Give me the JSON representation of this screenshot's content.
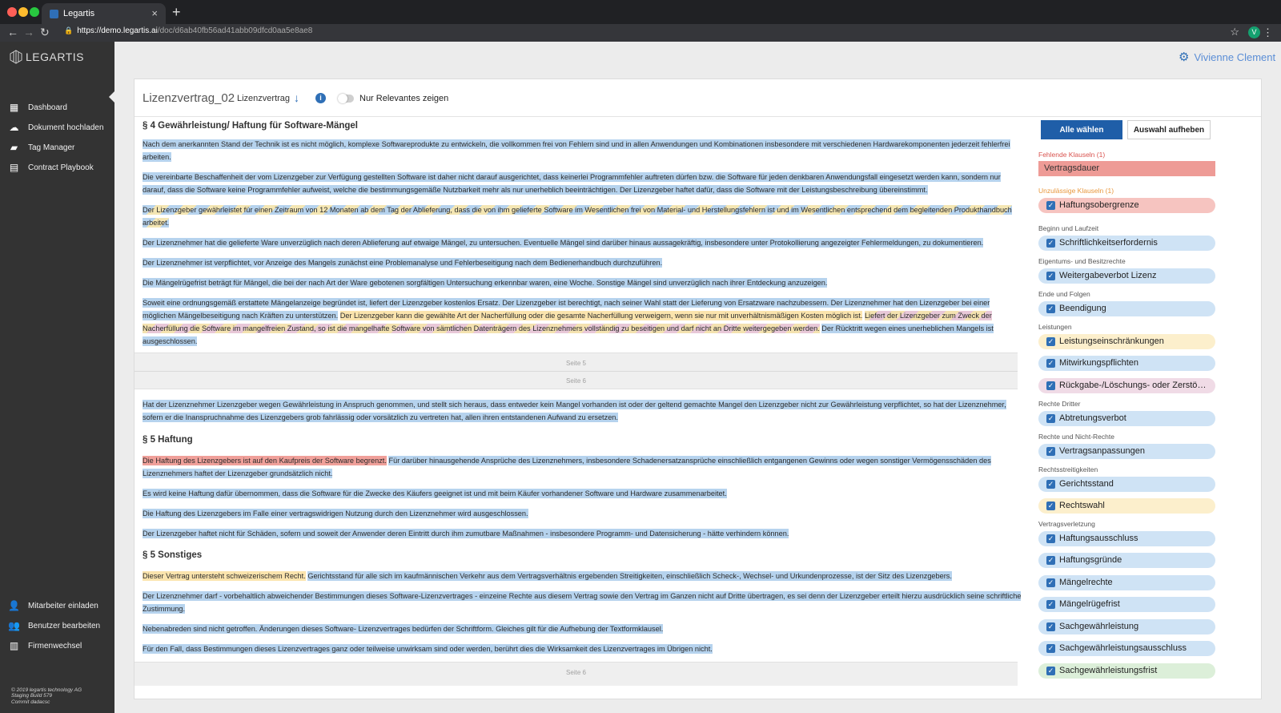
{
  "browser": {
    "tab_title": "Legartis",
    "tab_close": "×",
    "new_tab": "+",
    "url_host": "https://demo.legartis.ai",
    "url_path": "/doc/d6ab40fb56ad41abb09dfcd0aa5e8ae8",
    "profile_initial": "V"
  },
  "sidebar": {
    "logo": "LEGARTIS",
    "items": [
      {
        "label": "Dashboard",
        "icon": "dashboard-icon"
      },
      {
        "label": "Dokument hochladen",
        "icon": "cloud-upload-icon"
      },
      {
        "label": "Tag Manager",
        "icon": "tag-icon"
      },
      {
        "label": "Contract Playbook",
        "icon": "playbook-icon"
      }
    ],
    "bottom_items": [
      {
        "label": "Mitarbeiter einladen",
        "icon": "user-add-icon"
      },
      {
        "label": "Benutzer bearbeiten",
        "icon": "users-icon"
      },
      {
        "label": "Firmenwechsel",
        "icon": "building-icon"
      }
    ],
    "footer": [
      "© 2019 legartis technology AG",
      "Staging Build 579",
      "Commit dadacsc"
    ]
  },
  "user": {
    "name": "Vivienne Clement"
  },
  "doc": {
    "title": "Lizenzvertrag_02",
    "type": "Lizenzvertrag",
    "toggle_label": "Nur Relevantes zeigen",
    "page_labels": [
      "Seite 5",
      "Seite 6",
      "Seite 6"
    ],
    "sections": {
      "s4": "§ 4 Gewährleistung/ Haftung für Software-Mängel",
      "s5": "§ 5 Haftung",
      "s6": "§ 5 Sonstiges"
    },
    "p1": "Nach dem anerkannten Stand der Technik ist es nicht möglich, komplexe Softwareprodukte zu entwickeln, die vollkommen frei von Fehlern sind und in allen Anwendungen und Kombinationen insbesondere mit verschiedenen Hardwarekomponenten jederzeit fehlerfrei arbeiten.",
    "p2": "Die vereinbarte Beschaffenheit der vom Lizenzgeber zur Verfügung gestellten Software ist daher nicht darauf ausgerichtet, dass keinerlei Programmfehler auftreten dürfen bzw. die Software für jeden denkbaren Anwendungsfall eingesetzt werden kann, sondern nur darauf, dass die Software keine Programmfehler aufweist, welche die bestimmungsgemäße Nutzbarkeit mehr als nur unerheblich beeinträchtigen. Der Lizenzgeber haftet dafür, dass die Software mit der Leistungsbeschreibung übereinstimmt.",
    "p3": "Der Lizenzgeber gewährleistet für einen Zeitraum von 12 Monaten ab dem Tag der Ablieferung, dass die von ihm gelieferte Software im Wesentlichen frei von Material- und Herstellungsfehlern ist und im Wesentlichen entsprechend dem begleitenden Produkthandbuch arbeitet.",
    "p4": "Der Lizenznehmer hat die gelieferte Ware unverzüglich nach deren Ablieferung auf etwaige Mängel, zu untersuchen. Eventuelle Mängel sind darüber hinaus aussagekräftig, insbesondere unter Protokollierung angezeigter Fehlermeldungen, zu dokumentieren.",
    "p5": "Der Lizenznehmer ist verpflichtet, vor Anzeige des Mangels zunächst eine Problemanalyse und Fehlerbeseitigung nach dem Bedienerhandbuch durchzuführen.",
    "p6": "Die Mängelrügefrist beträgt für Mängel, die bei der nach Art der Ware gebotenen sorgfältigen Untersuchung erkennbar waren, eine Woche. Sonstige Mängel sind unverzüglich nach ihrer Entdeckung anzuzeigen.",
    "p7a": "Soweit eine ordnungsgemäß erstattete Mängelanzeige begründet ist, liefert der Lizenzgeber kostenlos Ersatz. Der Lizenzgeber ist berechtigt, nach seiner Wahl statt der Lieferung von Ersatzware nachzubessern. Der Lizenznehmer hat den Lizenzgeber bei einer möglichen Mängelbeseitigung nach Kräften zu unterstützen.",
    "p7b": "Der Lizenzgeber kann die gewählte Art der Nacherfüllung oder die gesamte Nacherfüllung verweigern, wenn sie nur mit unverhältnismäßigen Kosten möglich ist.",
    "p7c": "Liefert der Lizenzgeber zum Zweck der Nacherfüllung die Software im mangelfreien Zustand, so ist die mangelhafte Software von sämtlichen Datenträgern des Lizenznehmers vollständig zu beseitigen und darf nicht an Dritte weitergegeben werden.",
    "p7d": "Der Rücktritt wegen eines unerheblichen Mangels ist ausgeschlossen.",
    "p8": "Hat der Lizenznehmer Lizenzgeber wegen Gewährleistung in Anspruch genommen, und stellt sich heraus, dass entweder kein Mangel vorhanden ist oder der geltend gemachte Mangel den Lizenzgeber nicht zur Gewährleistung verpflichtet, so hat der Lizenznehmer, sofern er die Inanspruchnahme des Lizenzgebers grob fahrlässig oder vorsätzlich zu vertreten hat, allen ihren entstandenen Aufwand zu ersetzen.",
    "p9a": "Die Haftung des Lizenzgebers ist auf den Kaufpreis der Software begrenzt.",
    "p9b": "Für darüber hinausgehende Ansprüche des Lizenznehmers, insbesondere Schadenersatzansprüche einschließlich entgangenen Gewinns oder wegen sonstiger Vermögensschäden des Lizenznehmers haftet der Lizenzgeber grundsätzlich nicht.",
    "p10": "Es wird keine Haftung dafür übernommen, dass die Software für die Zwecke des Käufers geeignet ist und mit beim Käufer vorhandener Software und Hardware zusammenarbeitet.",
    "p11": "Die Haftung des Lizenzgebers im Falle einer vertragswidrigen Nutzung durch den Lizenznehmer wird ausgeschlossen.",
    "p12": "Der Lizenzgeber haftet nicht für Schäden, sofern und soweit der Anwender deren Eintritt durch ihm zumutbare Maßnahmen - insbesondere Programm- und Datensicherung - hätte verhindern können.",
    "p13a": "Dieser Vertrag untersteht schweizerischem Recht.",
    "p13b": "Gerichtsstand für alle sich im kaufmännischen Verkehr aus dem Vertragsverhältnis ergebenden Streitigkeiten, einschließlich Scheck-, Wechsel- und Urkundenprozesse, ist der Sitz des Lizenzgebers.",
    "p14": "Der Lizenznehmer darf - vorbehaltlich abweichender Bestimmungen dieses Software-Lizenzvertrages - einzeine Rechte aus diesem Vertrag sowie den Vertrag im Ganzen nicht auf Dritte übertragen, es sei denn der Lizenzgeber erteilt hierzu ausdrücklich seine schriftliche Zustimmung.",
    "p15": "Nebenabreden sind nicht getroffen. Änderungen dieses Software- Lizenzvertrages bedürfen der Schriftform. Gleiches gilt für die Aufhebung der Textformklausel.",
    "p16": "Für den Fall, dass Bestimmungen dieses Lizenzvertrages ganz oder teilweise unwirksam sind oder werden, berührt dies die Wirksamkeit des Lizenzvertrages im Übrigen nicht."
  },
  "panel": {
    "select_all": "Alle wählen",
    "clear_selection": "Auswahl aufheben",
    "missing_label": "Fehlende Klauseln (1)",
    "missing_items": [
      "Vertragsdauer"
    ],
    "invalid_label": "Unzulässige Klauseln (1)",
    "groups": [
      {
        "label": "Beginn und Laufzeit"
      },
      {
        "label": "Eigentums- und Besitzrechte"
      },
      {
        "label": "Ende und Folgen"
      },
      {
        "label": "Leistungen"
      },
      {
        "label": "Rechte Dritter"
      },
      {
        "label": "Rechte und Nicht-Rechte"
      },
      {
        "label": "Rechtsstreitigkeiten"
      },
      {
        "label": "Vertragsverletzung"
      }
    ],
    "clauses": [
      {
        "label": "Haftungsobergrenze",
        "color": "red"
      },
      {
        "label": "Schriftlichkeitserfordernis",
        "color": "blue"
      },
      {
        "label": "Weitergabeverbot Lizenz",
        "color": "blue"
      },
      {
        "label": "Beendigung",
        "color": "blue"
      },
      {
        "label": "Leistungseinschränkungen",
        "color": "yellow"
      },
      {
        "label": "Mitwirkungspflichten",
        "color": "blue"
      },
      {
        "label": "Rückgabe-/Löschungs- oder Zerstörungspflicht",
        "color": "pink"
      },
      {
        "label": "Abtretungsverbot",
        "color": "blue"
      },
      {
        "label": "Vertragsanpassungen",
        "color": "blue"
      },
      {
        "label": "Gerichtsstand",
        "color": "blue"
      },
      {
        "label": "Rechtswahl",
        "color": "yellow"
      },
      {
        "label": "Haftungsausschluss",
        "color": "blue"
      },
      {
        "label": "Haftungsgründe",
        "color": "blue"
      },
      {
        "label": "Mängelrechte",
        "color": "blue"
      },
      {
        "label": "Mängelrügefrist",
        "color": "blue"
      },
      {
        "label": "Sachgewährleistung",
        "color": "blue"
      },
      {
        "label": "Sachgewährleistungsausschluss",
        "color": "blue"
      },
      {
        "label": "Sachgewährleistungsfrist",
        "color": "green"
      }
    ],
    "check_glyph": "✓"
  }
}
